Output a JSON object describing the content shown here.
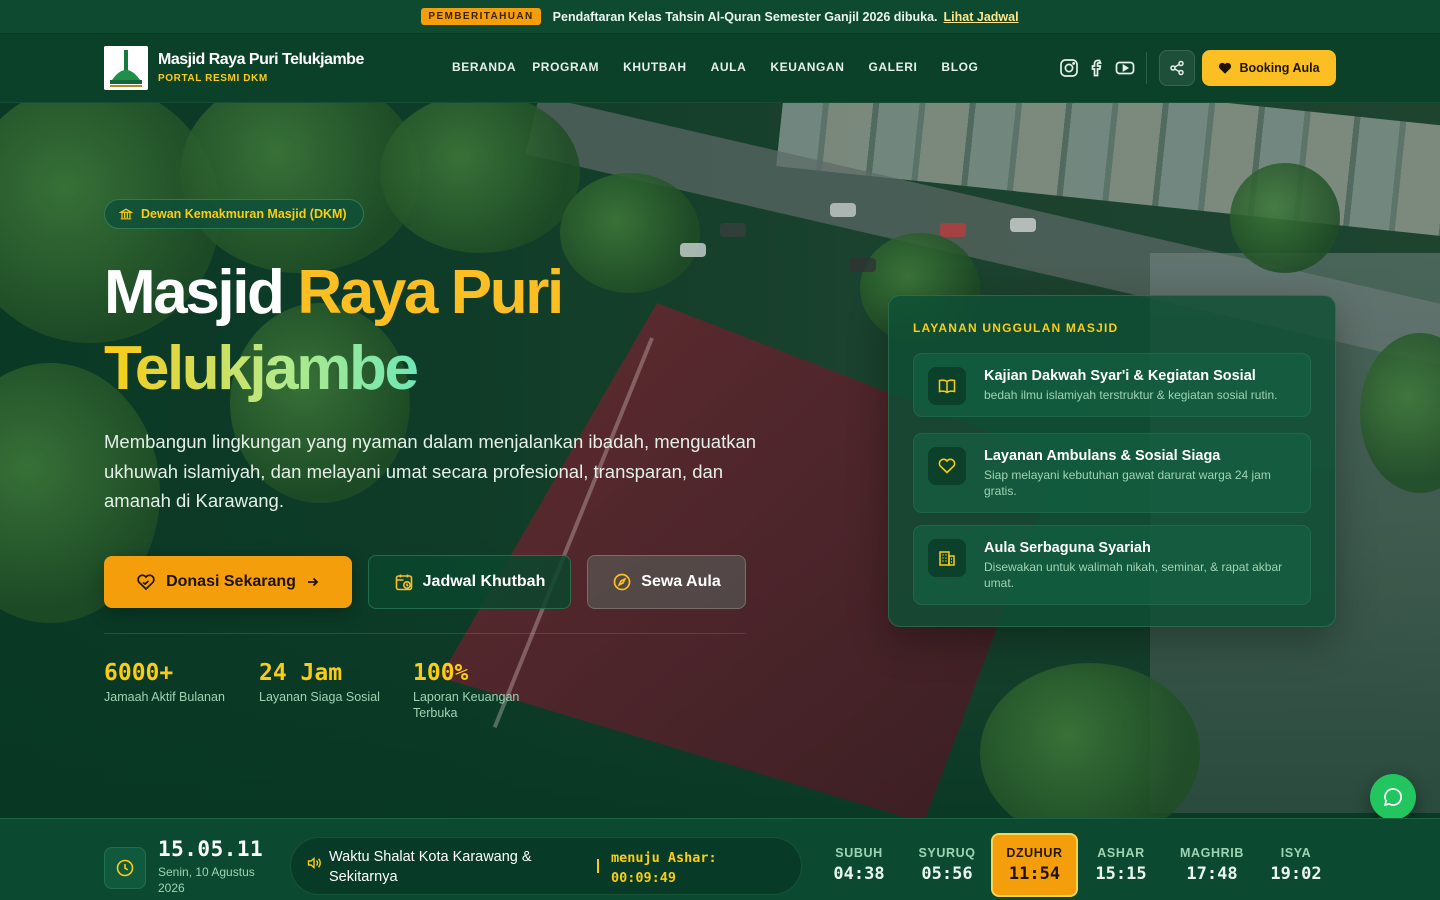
{
  "announcement": {
    "badge": "PEMBERITAHUAN",
    "message": "Pendaftaran Kelas Tahsin Al-Quran Semester Ganjil 2026 dibuka.",
    "link": "Lihat Jadwal"
  },
  "header": {
    "brand_title": "Masjid Raya Puri Telukjambe",
    "brand_subtitle": "PORTAL RESMI DKM",
    "nav": [
      "BERANDA",
      "PROGRAM",
      "KHUTBAH",
      "AULA",
      "KEUANGAN",
      "GALERI",
      "BLOG"
    ],
    "social_icons": [
      "instagram-icon",
      "facebook-icon",
      "youtube-icon"
    ],
    "share_icon": "share-icon",
    "booking_label": "Booking Aula"
  },
  "hero": {
    "badge": "Dewan Kemakmuran Masjid (DKM)",
    "title_white": "Masjid ",
    "title_yellow": "Raya Puri",
    "title_line2": "Telukjambe",
    "description": "Membangun lingkungan yang nyaman dalam menjalankan ibadah, menguatkan ukhuwah islamiyah, dan melayani umat secara profesional, transparan, dan amanah di Karawang.",
    "buttons": {
      "donasi": "Donasi Sekarang",
      "khutbah": "Jadwal Khutbah",
      "aula": "Sewa Aula"
    },
    "stats": [
      {
        "value": "6000+",
        "label": "Jamaah Aktif Bulanan"
      },
      {
        "value": "24 Jam",
        "label": "Layanan Siaga Sosial"
      },
      {
        "value": "100%",
        "label": "Laporan Keuangan Terbuka"
      }
    ]
  },
  "services": {
    "heading": "LAYANAN UNGGULAN MASJID",
    "items": [
      {
        "icon": "book-icon",
        "title": "Kajian Dakwah Syar'i & Kegiatan Sosial",
        "desc": "bedah ilmu islamiyah terstruktur & kegiatan sosial rutin."
      },
      {
        "icon": "heart-icon",
        "title": "Layanan Ambulans & Sosial Siaga",
        "desc": "Siap melayani kebutuhan gawat darurat warga 24 jam gratis."
      },
      {
        "icon": "building-icon",
        "title": "Aula Serbaguna Syariah",
        "desc": "Disewakan untuk walimah nikah, seminar, & rapat akbar umat."
      }
    ]
  },
  "prayer": {
    "clock": "15.05.11",
    "date": "Senin, 10 Agustus 2026",
    "location": "Waktu Shalat Kota Karawang & Sekitarnya",
    "next_label": "menuju Ashar:",
    "countdown": "00:09:49",
    "times": [
      {
        "name": "SUBUH",
        "time": "04:38",
        "active": false
      },
      {
        "name": "SYURUQ",
        "time": "05:56",
        "active": false
      },
      {
        "name": "DZUHUR",
        "time": "11:54",
        "active": true
      },
      {
        "name": "ASHAR",
        "time": "15:15",
        "active": false
      },
      {
        "name": "MAGHRIB",
        "time": "17:48",
        "active": false
      },
      {
        "name": "ISYA",
        "time": "19:02",
        "active": false
      }
    ]
  },
  "colors": {
    "primary_green": "#0b4129",
    "accent_yellow": "#facc15",
    "accent_orange": "#f59e0b",
    "whatsapp_green": "#22c55e"
  }
}
